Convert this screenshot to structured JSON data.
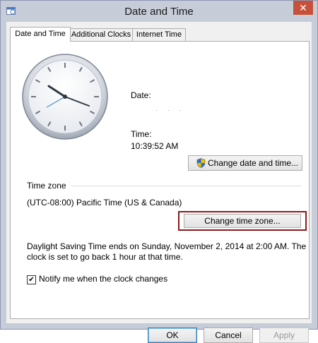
{
  "window": {
    "title": "Date and Time",
    "close_glyph": "✕",
    "app_icon": "calendar-clock-icon"
  },
  "tabs": [
    {
      "label": "Date and Time",
      "active": true
    },
    {
      "label": "Additional Clocks",
      "active": false
    },
    {
      "label": "Internet Time",
      "active": false
    }
  ],
  "datetime": {
    "date_label": "Date:",
    "time_label": "Time:",
    "time_value": "10:39:52 AM",
    "change_button": "Change date and time...",
    "shield_icon": "uac-shield-icon"
  },
  "timezone": {
    "section_label": "Time zone",
    "value": "(UTC-08:00) Pacific Time (US & Canada)",
    "change_button": "Change time zone...",
    "highlight_color": "#8b1a1a"
  },
  "dst": {
    "line1": "Daylight Saving Time ends on Sunday, November 2, 2014 at 2:00 AM. The",
    "line2": "clock is set to go back 1 hour at that time."
  },
  "notify": {
    "label": "Notify me when the clock changes",
    "checked": true,
    "check_glyph": "✔"
  },
  "footer": {
    "ok": "OK",
    "cancel": "Cancel",
    "apply": "Apply"
  }
}
